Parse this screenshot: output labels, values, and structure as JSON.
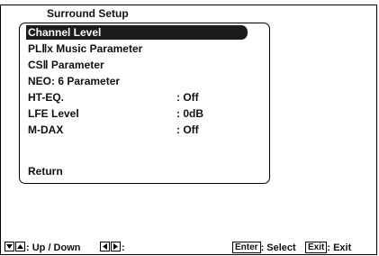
{
  "header": {
    "title": "Surround Setup"
  },
  "menu": {
    "items": [
      {
        "label": "Channel Level",
        "value": ""
      },
      {
        "label": "PLⅡx Music Parameter",
        "value": ""
      },
      {
        "label": "CSⅡ Parameter",
        "value": ""
      },
      {
        "label": "NEO: 6 Parameter",
        "value": ""
      },
      {
        "label": "HT-EQ.",
        "value": ": Off"
      },
      {
        "label": "LFE Level",
        "value": ": 0dB"
      },
      {
        "label": "M-DAX",
        "value": ": Off"
      }
    ],
    "selected_index": 0,
    "return_label": "Return"
  },
  "footer": {
    "updown_text": ": Up / Down",
    "leftright_text": ":",
    "enter_key": "Enter",
    "enter_text": ": Select",
    "exit_key": "Exit",
    "exit_text": ": Exit"
  },
  "colors": {
    "highlight": "#1b1b1b",
    "text": "#111111",
    "background": "#ffffff"
  }
}
